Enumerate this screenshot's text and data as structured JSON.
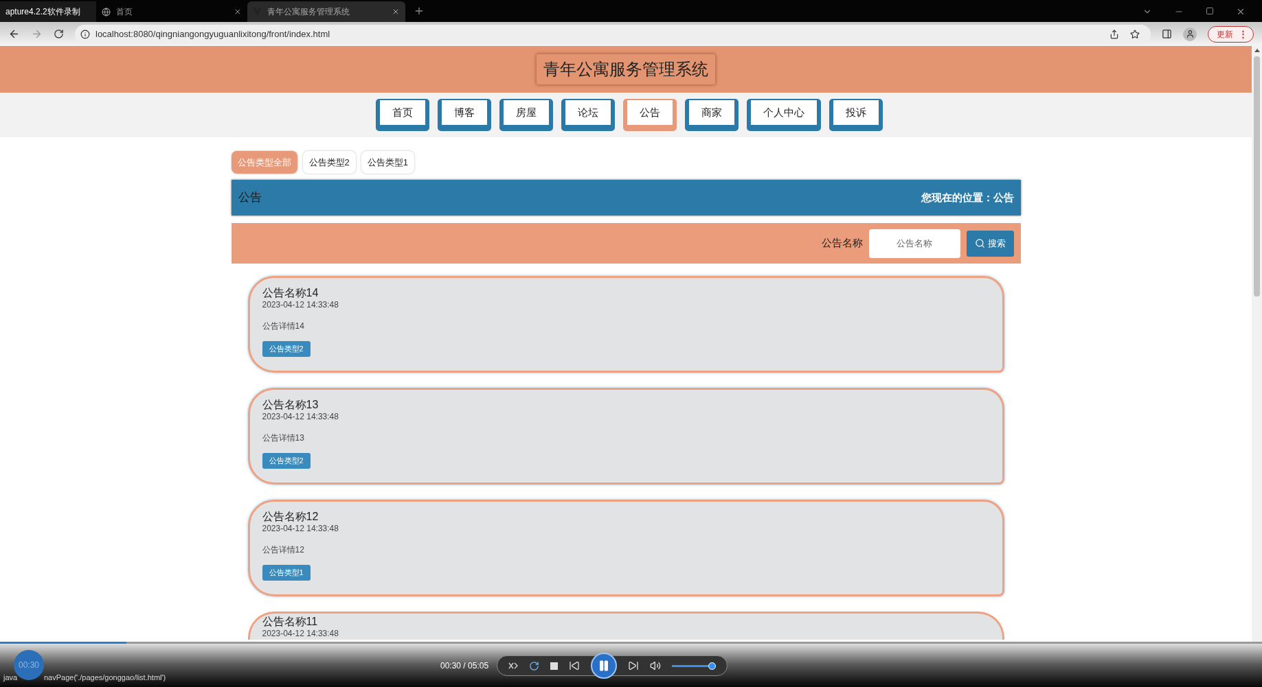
{
  "browser": {
    "tabs": [
      {
        "label": "apture4.2.2软件录制",
        "selected": false
      },
      {
        "label": "首页",
        "selected": false
      },
      {
        "label": "青年公寓服务管理系统",
        "selected": true
      }
    ],
    "url": "localhost:8080/qingniangongyuguanlixitong/front/index.html",
    "update_button": "更新",
    "menu_button": "⋮"
  },
  "site_title": "青年公寓服务管理系统",
  "nav": [
    {
      "label": "首页",
      "selected": false
    },
    {
      "label": "博客",
      "selected": false
    },
    {
      "label": "房屋",
      "selected": false
    },
    {
      "label": "论坛",
      "selected": false
    },
    {
      "label": "公告",
      "selected": true
    },
    {
      "label": "商家",
      "selected": false
    },
    {
      "label": "个人中心",
      "selected": false
    },
    {
      "label": "投诉",
      "selected": false
    }
  ],
  "filters": [
    {
      "label": "公告类型全部",
      "selected": true
    },
    {
      "label": "公告类型2",
      "selected": false
    },
    {
      "label": "公告类型1",
      "selected": false
    }
  ],
  "section": {
    "title": "公告",
    "breadcrumb": "您现在的位置：公告"
  },
  "search": {
    "label": "公告名称",
    "placeholder": "公告名称",
    "button": "搜索"
  },
  "notices": [
    {
      "title": "公告名称14",
      "date": "2023-04-12 14:33:48",
      "detail": "公告详情14",
      "tag": "公告类型2"
    },
    {
      "title": "公告名称13",
      "date": "2023-04-12 14:33:48",
      "detail": "公告详情13",
      "tag": "公告类型2"
    },
    {
      "title": "公告名称12",
      "date": "2023-04-12 14:33:48",
      "detail": "公告详情12",
      "tag": "公告类型1"
    },
    {
      "title": "公告名称11",
      "date": "2023-04-12 14:33:48"
    }
  ],
  "player": {
    "progress": {
      "level": 0.1
    },
    "bubble_time": "00:30",
    "status_start": "java",
    "status_end": "navPage('./pages/gonggao/list.html')",
    "time": "00:30 / 05:05",
    "volume": {
      "level": 0.9
    }
  }
}
